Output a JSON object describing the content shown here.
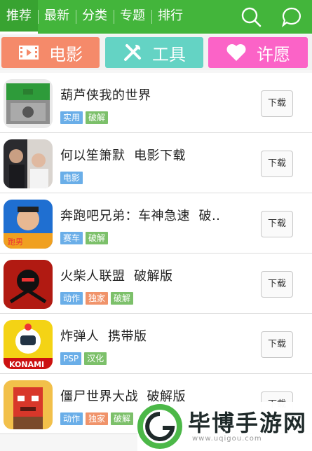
{
  "tabs": [
    {
      "label": "推荐",
      "active": true
    },
    {
      "label": "最新",
      "active": false
    },
    {
      "label": "分类",
      "active": false
    },
    {
      "label": "专题",
      "active": false
    },
    {
      "label": "排行",
      "active": false
    }
  ],
  "header_icons": [
    "search-icon",
    "chat-icon"
  ],
  "categories": [
    {
      "label": "电影",
      "icon": "film-icon",
      "color": "#f58a6a"
    },
    {
      "label": "工具",
      "icon": "tools-icon",
      "color": "#64d3c4"
    },
    {
      "label": "许愿",
      "icon": "heart-icon",
      "color": "#fb63c7"
    }
  ],
  "download_label": "下载",
  "apps": [
    {
      "title": "葫芦侠我的世界",
      "tags": [
        {
          "text": "实用",
          "color": "#6aaee8"
        },
        {
          "text": "破解",
          "color": "#7cc06a"
        }
      ]
    },
    {
      "title": "何以笙箫默  电影下载",
      "tags": [
        {
          "text": "电影",
          "color": "#6aaee8"
        }
      ]
    },
    {
      "title": "奔跑吧兄弟：车神急速  破..",
      "tags": [
        {
          "text": "赛车",
          "color": "#6aaee8"
        },
        {
          "text": "破解",
          "color": "#7cc06a"
        }
      ]
    },
    {
      "title": "火柴人联盟  破解版",
      "tags": [
        {
          "text": "动作",
          "color": "#6aaee8"
        },
        {
          "text": "独家",
          "color": "#f0936a"
        },
        {
          "text": "破解",
          "color": "#7cc06a"
        }
      ]
    },
    {
      "title": "炸弹人  携带版",
      "tags": [
        {
          "text": "PSP",
          "color": "#6aaee8"
        },
        {
          "text": "汉化",
          "color": "#7cc06a"
        }
      ]
    },
    {
      "title": "僵尸世界大战  破解版",
      "tags": [
        {
          "text": "动作",
          "color": "#6aaee8"
        },
        {
          "text": "独家",
          "color": "#f0936a"
        },
        {
          "text": "破解",
          "color": "#7cc06a"
        }
      ]
    }
  ],
  "watermark": {
    "name": "毕博手游网",
    "url": "www.uqigou.com"
  }
}
